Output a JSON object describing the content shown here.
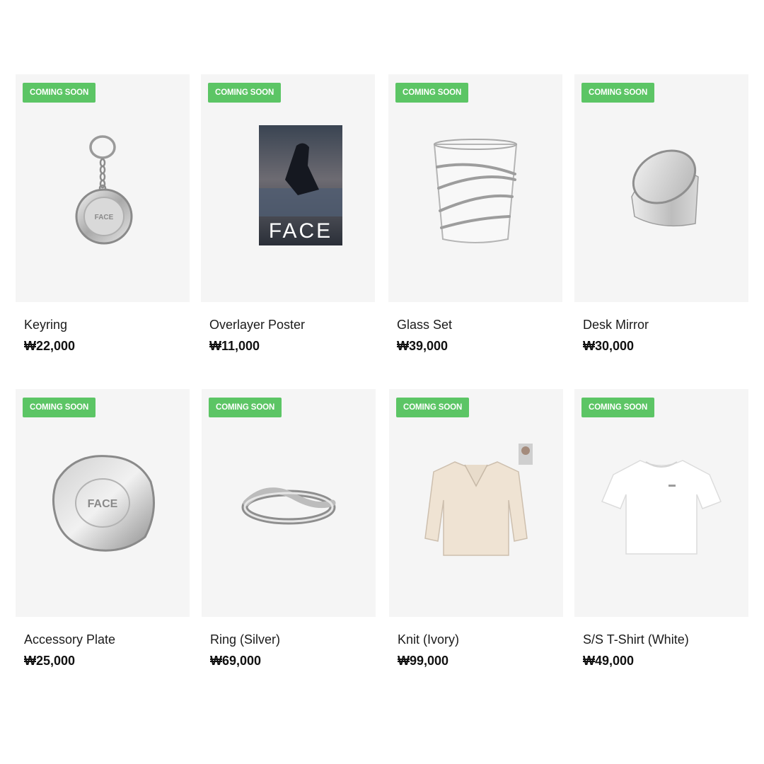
{
  "badge_color": "#5cc565",
  "products": [
    {
      "name": "Keyring",
      "price": "₩22,000",
      "badge": "COMING SOON",
      "icon": "keyring-icon"
    },
    {
      "name": "Overlayer Poster",
      "price": "₩11,000",
      "badge": "COMING SOON",
      "icon": "poster-icon",
      "poster_text": "FACE"
    },
    {
      "name": "Glass Set",
      "price": "₩39,000",
      "badge": "COMING SOON",
      "icon": "glass-icon"
    },
    {
      "name": "Desk Mirror",
      "price": "₩30,000",
      "badge": "COMING SOON",
      "icon": "mirror-icon"
    },
    {
      "name": "Accessory Plate",
      "price": "₩25,000",
      "badge": "COMING SOON",
      "icon": "plate-icon"
    },
    {
      "name": "Ring (Silver)",
      "price": "₩69,000",
      "badge": "COMING SOON",
      "icon": "ring-icon"
    },
    {
      "name": "Knit (Ivory)",
      "price": "₩99,000",
      "badge": "COMING SOON",
      "icon": "knit-icon"
    },
    {
      "name": "S/S T-Shirt (White)",
      "price": "₩49,000",
      "badge": "COMING SOON",
      "icon": "tshirt-icon"
    }
  ]
}
